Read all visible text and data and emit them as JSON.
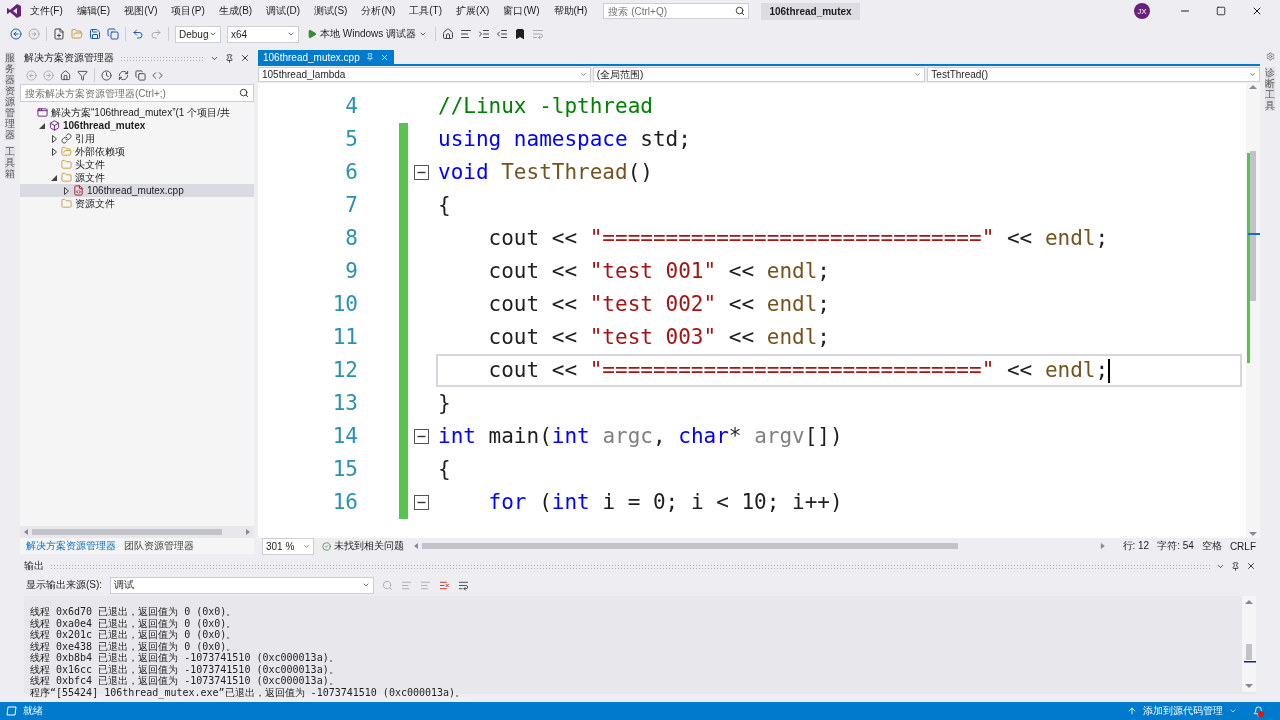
{
  "menu": {
    "items": [
      "文件(F)",
      "编辑(E)",
      "视图(V)",
      "项目(P)",
      "生成(B)",
      "调试(D)",
      "测试(S)",
      "分析(N)",
      "工具(T)",
      "扩展(X)",
      "窗口(W)",
      "帮助(H)"
    ]
  },
  "search": {
    "placeholder": "搜索 (Ctrl+Q)"
  },
  "window": {
    "title": "106thread_mutex"
  },
  "user": {
    "initials": "JX"
  },
  "toolbar": {
    "configuration": "Debug",
    "platform": "x64",
    "run_label": "本地 Windows 调试器"
  },
  "side_strips": {
    "left": [
      "服务器资源管理器",
      "工具箱"
    ],
    "right": [
      "诊断工具"
    ]
  },
  "solution_explorer": {
    "title": "解决方案资源管理器",
    "search": {
      "placeholder": "搜索解决方案资源管理器(Ctrl+;)"
    },
    "tree": [
      {
        "kind": "solution",
        "label": "解决方案“106thread_mutex”(1 个项目/共",
        "selected": false,
        "children": [
          {
            "kind": "project",
            "label": "106thread_mutex",
            "selected": false,
            "expanded": true,
            "children": [
              {
                "kind": "references",
                "label": "引用",
                "selected": false,
                "expanded": false
              },
              {
                "kind": "dependencies",
                "label": "外部依赖项",
                "selected": false,
                "expanded": false
              },
              {
                "kind": "folder",
                "label": "头文件",
                "selected": false
              },
              {
                "kind": "folder",
                "label": "源文件",
                "selected": false,
                "expanded": true,
                "children": [
                  {
                    "kind": "file",
                    "label": "106thread_mutex.cpp",
                    "selected": true,
                    "expanded": false
                  }
                ]
              },
              {
                "kind": "folder",
                "label": "资源文件",
                "selected": false
              }
            ]
          }
        ]
      }
    ],
    "tabs": [
      {
        "label": "解决方案资源管理器",
        "selected": true
      },
      {
        "label": "团队资源管理器",
        "selected": false
      }
    ]
  },
  "editor": {
    "tabs": [
      {
        "label": "106thread_mutex.cpp",
        "selected": true
      }
    ],
    "nav": [
      "105thread_lambda",
      "(全局范围)",
      "TestThread()"
    ],
    "lines": [
      {
        "number": "4",
        "changed": false,
        "foldable": false,
        "current": false,
        "tokens": [
          {
            "kind": "comment",
            "text": "//Linux -lpthread"
          }
        ]
      },
      {
        "number": "5",
        "changed": true,
        "foldable": false,
        "current": false,
        "tokens": [
          {
            "kind": "keyword",
            "text": "using namespace"
          },
          {
            "kind": "plain",
            "text": " std;"
          }
        ]
      },
      {
        "number": "6",
        "changed": true,
        "foldable": true,
        "current": false,
        "tokens": [
          {
            "kind": "keyword",
            "text": "void"
          },
          {
            "kind": "function",
            "text": " TestThread"
          },
          {
            "kind": "plain",
            "text": "()"
          }
        ]
      },
      {
        "number": "7",
        "changed": true,
        "foldable": false,
        "current": false,
        "tokens": [
          {
            "kind": "plain",
            "text": "{"
          }
        ]
      },
      {
        "number": "8",
        "changed": true,
        "foldable": false,
        "current": false,
        "tokens": [
          {
            "kind": "plain",
            "text": "    cout << "
          },
          {
            "kind": "string",
            "text": "\"==============================\""
          },
          {
            "kind": "plain",
            "text": " << "
          },
          {
            "kind": "function",
            "text": "endl"
          },
          {
            "kind": "plain",
            "text": ";"
          }
        ]
      },
      {
        "number": "9",
        "changed": true,
        "foldable": false,
        "current": false,
        "tokens": [
          {
            "kind": "plain",
            "text": "    cout << "
          },
          {
            "kind": "string",
            "text": "\"test 001\""
          },
          {
            "kind": "plain",
            "text": " << "
          },
          {
            "kind": "function",
            "text": "endl"
          },
          {
            "kind": "plain",
            "text": ";"
          }
        ]
      },
      {
        "number": "10",
        "changed": true,
        "foldable": false,
        "current": false,
        "tokens": [
          {
            "kind": "plain",
            "text": "    cout << "
          },
          {
            "kind": "string",
            "text": "\"test 002\""
          },
          {
            "kind": "plain",
            "text": " << "
          },
          {
            "kind": "function",
            "text": "endl"
          },
          {
            "kind": "plain",
            "text": ";"
          }
        ]
      },
      {
        "number": "11",
        "changed": true,
        "foldable": false,
        "current": false,
        "tokens": [
          {
            "kind": "plain",
            "text": "    cout << "
          },
          {
            "kind": "string",
            "text": "\"test 003\""
          },
          {
            "kind": "plain",
            "text": " << "
          },
          {
            "kind": "function",
            "text": "endl"
          },
          {
            "kind": "plain",
            "text": ";"
          }
        ]
      },
      {
        "number": "12",
        "changed": true,
        "foldable": false,
        "current": true,
        "tokens": [
          {
            "kind": "plain",
            "text": "    cout << "
          },
          {
            "kind": "string",
            "text": "\"==============================\""
          },
          {
            "kind": "plain",
            "text": " << "
          },
          {
            "kind": "function",
            "text": "endl"
          },
          {
            "kind": "plain",
            "text": ";"
          }
        ]
      },
      {
        "number": "13",
        "changed": true,
        "foldable": false,
        "current": false,
        "tokens": [
          {
            "kind": "plain",
            "text": "}"
          }
        ]
      },
      {
        "number": "14",
        "changed": true,
        "foldable": true,
        "current": false,
        "tokens": [
          {
            "kind": "keyword",
            "text": "int"
          },
          {
            "kind": "plain",
            "text": " main("
          },
          {
            "kind": "keyword",
            "text": "int"
          },
          {
            "kind": "param",
            "text": " argc"
          },
          {
            "kind": "plain",
            "text": ", "
          },
          {
            "kind": "keyword",
            "text": "char"
          },
          {
            "kind": "plain",
            "text": "* "
          },
          {
            "kind": "param",
            "text": "argv"
          },
          {
            "kind": "plain",
            "text": "[])"
          }
        ]
      },
      {
        "number": "15",
        "changed": true,
        "foldable": false,
        "current": false,
        "tokens": [
          {
            "kind": "plain",
            "text": "{"
          }
        ]
      },
      {
        "number": "16",
        "changed": true,
        "foldable": true,
        "current": false,
        "tokens": [
          {
            "kind": "keyword",
            "text": "    for"
          },
          {
            "kind": "plain",
            "text": " ("
          },
          {
            "kind": "keyword",
            "text": "int"
          },
          {
            "kind": "plain",
            "text": " i = 0; i < 10; i++)"
          }
        ]
      }
    ],
    "zoom": "301 %",
    "issues": "未找到相关问题",
    "status": [
      "行: 12",
      "字符: 54",
      "空格",
      "CRLF"
    ]
  },
  "output": {
    "title": "输出",
    "source_label": "显示输出来源(S):",
    "source": "调试",
    "lines": [
      "线程 0x6d70 已退出，返回值为 0 (0x0)。",
      "线程 0xa0e4 已退出，返回值为 0 (0x0)。",
      "线程 0x201c 已退出，返回值为 0 (0x0)。",
      "线程 0xe438 已退出，返回值为 0 (0x0)。",
      "线程 0xb8b4 已退出，返回值为 -1073741510 (0xc000013a)。",
      "线程 0x16cc 已退出，返回值为 -1073741510 (0xc000013a)。",
      "线程 0xbfc4 已退出，返回值为 -1073741510 (0xc000013a)。",
      "程序“[55424] 106thread_mutex.exe”已退出，返回值为 -1073741510 (0xc000013a)。"
    ]
  },
  "status_bar": {
    "left": "就绪",
    "right": "添加到源代码管理"
  }
}
